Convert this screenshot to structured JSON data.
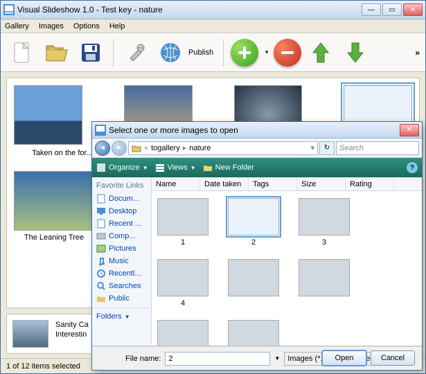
{
  "window": {
    "title": "Visual Slideshow 1.0 - Test key - nature",
    "menu": {
      "gallery": "Gallery",
      "images": "Images",
      "options": "Options",
      "help": "Help"
    },
    "toolbar": {
      "publish": "Publish"
    },
    "status": "1 of 12 items selected"
  },
  "gallery": {
    "captions": [
      "Taken on the for...",
      "",
      "",
      ""
    ],
    "row2_captions": [
      "The Leaning Tree"
    ],
    "detail": {
      "line1": "Sanity Ca",
      "line2": "Interestin"
    }
  },
  "dialog": {
    "title": "Select one or more images to open",
    "breadcrumb": {
      "seg1": "togallery",
      "seg2": "nature"
    },
    "search_placeholder": "Search",
    "toolbar": {
      "organize": "Organize",
      "views": "Views",
      "newfolder": "New Folder"
    },
    "favs_title": "Favorite Links",
    "favs": [
      "Docum...",
      "Desktop",
      "Recent ...",
      "Comp...",
      "Pictures",
      "Music",
      "Recentl...",
      "Searches",
      "Public"
    ],
    "folders_label": "Folders",
    "columns": [
      "Name",
      "Date taken",
      "Tags",
      "Size",
      "Rating"
    ],
    "files": [
      "1",
      "2",
      "3",
      "4",
      "",
      "",
      "",
      ""
    ],
    "selected": "2",
    "filename_label": "File name:",
    "filename_value": "2",
    "filter": "Images (*.bmp *.dib *.rle *.jpg *",
    "open": "Open",
    "cancel": "Cancel"
  }
}
